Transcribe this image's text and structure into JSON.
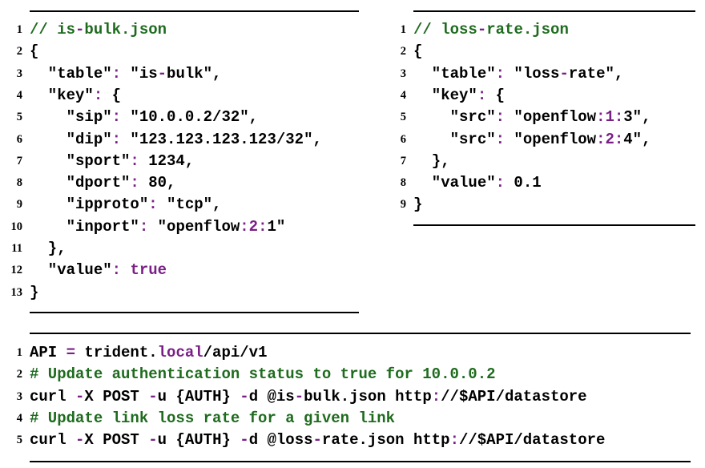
{
  "listings": [
    {
      "id": "is-bulk",
      "lines": [
        {
          "n": "1",
          "segs": [
            {
              "t": "// is",
              "c": "cm"
            },
            {
              "t": "-",
              "c": "kw"
            },
            {
              "t": "bulk.json",
              "c": "cm"
            }
          ]
        },
        {
          "n": "2",
          "segs": [
            {
              "t": "{",
              "c": "pl"
            }
          ]
        },
        {
          "n": "3",
          "segs": [
            {
              "t": "  \"table\"",
              "c": "pl"
            },
            {
              "t": ":",
              "c": "kw"
            },
            {
              "t": " \"is",
              "c": "pl"
            },
            {
              "t": "-",
              "c": "kw"
            },
            {
              "t": "bulk\",",
              "c": "pl"
            }
          ]
        },
        {
          "n": "4",
          "segs": [
            {
              "t": "  \"key\"",
              "c": "pl"
            },
            {
              "t": ":",
              "c": "kw"
            },
            {
              "t": " {",
              "c": "pl"
            }
          ]
        },
        {
          "n": "5",
          "segs": [
            {
              "t": "    \"sip\"",
              "c": "pl"
            },
            {
              "t": ":",
              "c": "kw"
            },
            {
              "t": " \"10.0.0.2/32\",",
              "c": "pl"
            }
          ]
        },
        {
          "n": "6",
          "segs": [
            {
              "t": "    \"dip\"",
              "c": "pl"
            },
            {
              "t": ":",
              "c": "kw"
            },
            {
              "t": " \"123.123.123.123/32\",",
              "c": "pl"
            }
          ]
        },
        {
          "n": "7",
          "segs": [
            {
              "t": "    \"sport\"",
              "c": "pl"
            },
            {
              "t": ":",
              "c": "kw"
            },
            {
              "t": " 1234,",
              "c": "pl"
            }
          ]
        },
        {
          "n": "8",
          "segs": [
            {
              "t": "    \"dport\"",
              "c": "pl"
            },
            {
              "t": ":",
              "c": "kw"
            },
            {
              "t": " 80,",
              "c": "pl"
            }
          ]
        },
        {
          "n": "9",
          "segs": [
            {
              "t": "    \"ipproto\"",
              "c": "pl"
            },
            {
              "t": ":",
              "c": "kw"
            },
            {
              "t": " \"tcp\",",
              "c": "pl"
            }
          ]
        },
        {
          "n": "10",
          "segs": [
            {
              "t": "    \"inport\"",
              "c": "pl"
            },
            {
              "t": ":",
              "c": "kw"
            },
            {
              "t": " \"openflow",
              "c": "pl"
            },
            {
              "t": ":2:",
              "c": "kw"
            },
            {
              "t": "1\"",
              "c": "pl"
            }
          ]
        },
        {
          "n": "11",
          "segs": [
            {
              "t": "  },",
              "c": "pl"
            }
          ]
        },
        {
          "n": "12",
          "segs": [
            {
              "t": "  \"value\"",
              "c": "pl"
            },
            {
              "t": ":",
              "c": "kw"
            },
            {
              "t": " ",
              "c": "pl"
            },
            {
              "t": "true",
              "c": "kw"
            }
          ]
        },
        {
          "n": "13",
          "segs": [
            {
              "t": "}",
              "c": "pl"
            }
          ]
        }
      ]
    },
    {
      "id": "loss-rate",
      "lines": [
        {
          "n": "1",
          "segs": [
            {
              "t": "// loss",
              "c": "cm"
            },
            {
              "t": "-",
              "c": "kw"
            },
            {
              "t": "rate.json",
              "c": "cm"
            }
          ]
        },
        {
          "n": "2",
          "segs": [
            {
              "t": "{",
              "c": "pl"
            }
          ]
        },
        {
          "n": "3",
          "segs": [
            {
              "t": "  \"table\"",
              "c": "pl"
            },
            {
              "t": ":",
              "c": "kw"
            },
            {
              "t": " \"loss",
              "c": "pl"
            },
            {
              "t": "-",
              "c": "kw"
            },
            {
              "t": "rate\",",
              "c": "pl"
            }
          ]
        },
        {
          "n": "4",
          "segs": [
            {
              "t": "  \"key\"",
              "c": "pl"
            },
            {
              "t": ":",
              "c": "kw"
            },
            {
              "t": " {",
              "c": "pl"
            }
          ]
        },
        {
          "n": "5",
          "segs": [
            {
              "t": "    \"src\"",
              "c": "pl"
            },
            {
              "t": ":",
              "c": "kw"
            },
            {
              "t": " \"openflow",
              "c": "pl"
            },
            {
              "t": ":1:",
              "c": "kw"
            },
            {
              "t": "3\",",
              "c": "pl"
            }
          ]
        },
        {
          "n": "6",
          "segs": [
            {
              "t": "    \"src\"",
              "c": "pl"
            },
            {
              "t": ":",
              "c": "kw"
            },
            {
              "t": " \"openflow",
              "c": "pl"
            },
            {
              "t": ":2:",
              "c": "kw"
            },
            {
              "t": "4\",",
              "c": "pl"
            }
          ]
        },
        {
          "n": "7",
          "segs": [
            {
              "t": "  },",
              "c": "pl"
            }
          ]
        },
        {
          "n": "8",
          "segs": [
            {
              "t": "  \"value\"",
              "c": "pl"
            },
            {
              "t": ":",
              "c": "kw"
            },
            {
              "t": " 0.1",
              "c": "pl"
            }
          ]
        },
        {
          "n": "9",
          "segs": [
            {
              "t": "}",
              "c": "pl"
            }
          ]
        }
      ]
    },
    {
      "id": "curl-commands",
      "lines": [
        {
          "n": "1",
          "segs": [
            {
              "t": "API ",
              "c": "pl"
            },
            {
              "t": "=",
              "c": "kw"
            },
            {
              "t": " trident.",
              "c": "pl"
            },
            {
              "t": "local",
              "c": "kw"
            },
            {
              "t": "/api/v1",
              "c": "pl"
            }
          ]
        },
        {
          "n": "2",
          "segs": [
            {
              "t": "# Update authentication status to true for 10.0.0.2",
              "c": "cm"
            }
          ]
        },
        {
          "n": "3",
          "segs": [
            {
              "t": "curl ",
              "c": "pl"
            },
            {
              "t": "-",
              "c": "kw"
            },
            {
              "t": "X POST ",
              "c": "pl"
            },
            {
              "t": "-",
              "c": "kw"
            },
            {
              "t": "u {AUTH} ",
              "c": "pl"
            },
            {
              "t": "-",
              "c": "kw"
            },
            {
              "t": "d @is",
              "c": "pl"
            },
            {
              "t": "-",
              "c": "kw"
            },
            {
              "t": "bulk.json http",
              "c": "pl"
            },
            {
              "t": ":",
              "c": "kw"
            },
            {
              "t": "//$API/datastore",
              "c": "pl"
            }
          ]
        },
        {
          "n": "4",
          "segs": [
            {
              "t": "# Update link loss rate for a given link",
              "c": "cm"
            }
          ]
        },
        {
          "n": "5",
          "segs": [
            {
              "t": "curl ",
              "c": "pl"
            },
            {
              "t": "-",
              "c": "kw"
            },
            {
              "t": "X POST ",
              "c": "pl"
            },
            {
              "t": "-",
              "c": "kw"
            },
            {
              "t": "u {AUTH} ",
              "c": "pl"
            },
            {
              "t": "-",
              "c": "kw"
            },
            {
              "t": "d @loss",
              "c": "pl"
            },
            {
              "t": "-",
              "c": "kw"
            },
            {
              "t": "rate.json http",
              "c": "pl"
            },
            {
              "t": ":",
              "c": "kw"
            },
            {
              "t": "//$API/datastore",
              "c": "pl"
            }
          ]
        }
      ]
    }
  ],
  "colors": {
    "comment": "#1e6b1e",
    "keyword": "#7a1f86",
    "text": "#000000"
  }
}
